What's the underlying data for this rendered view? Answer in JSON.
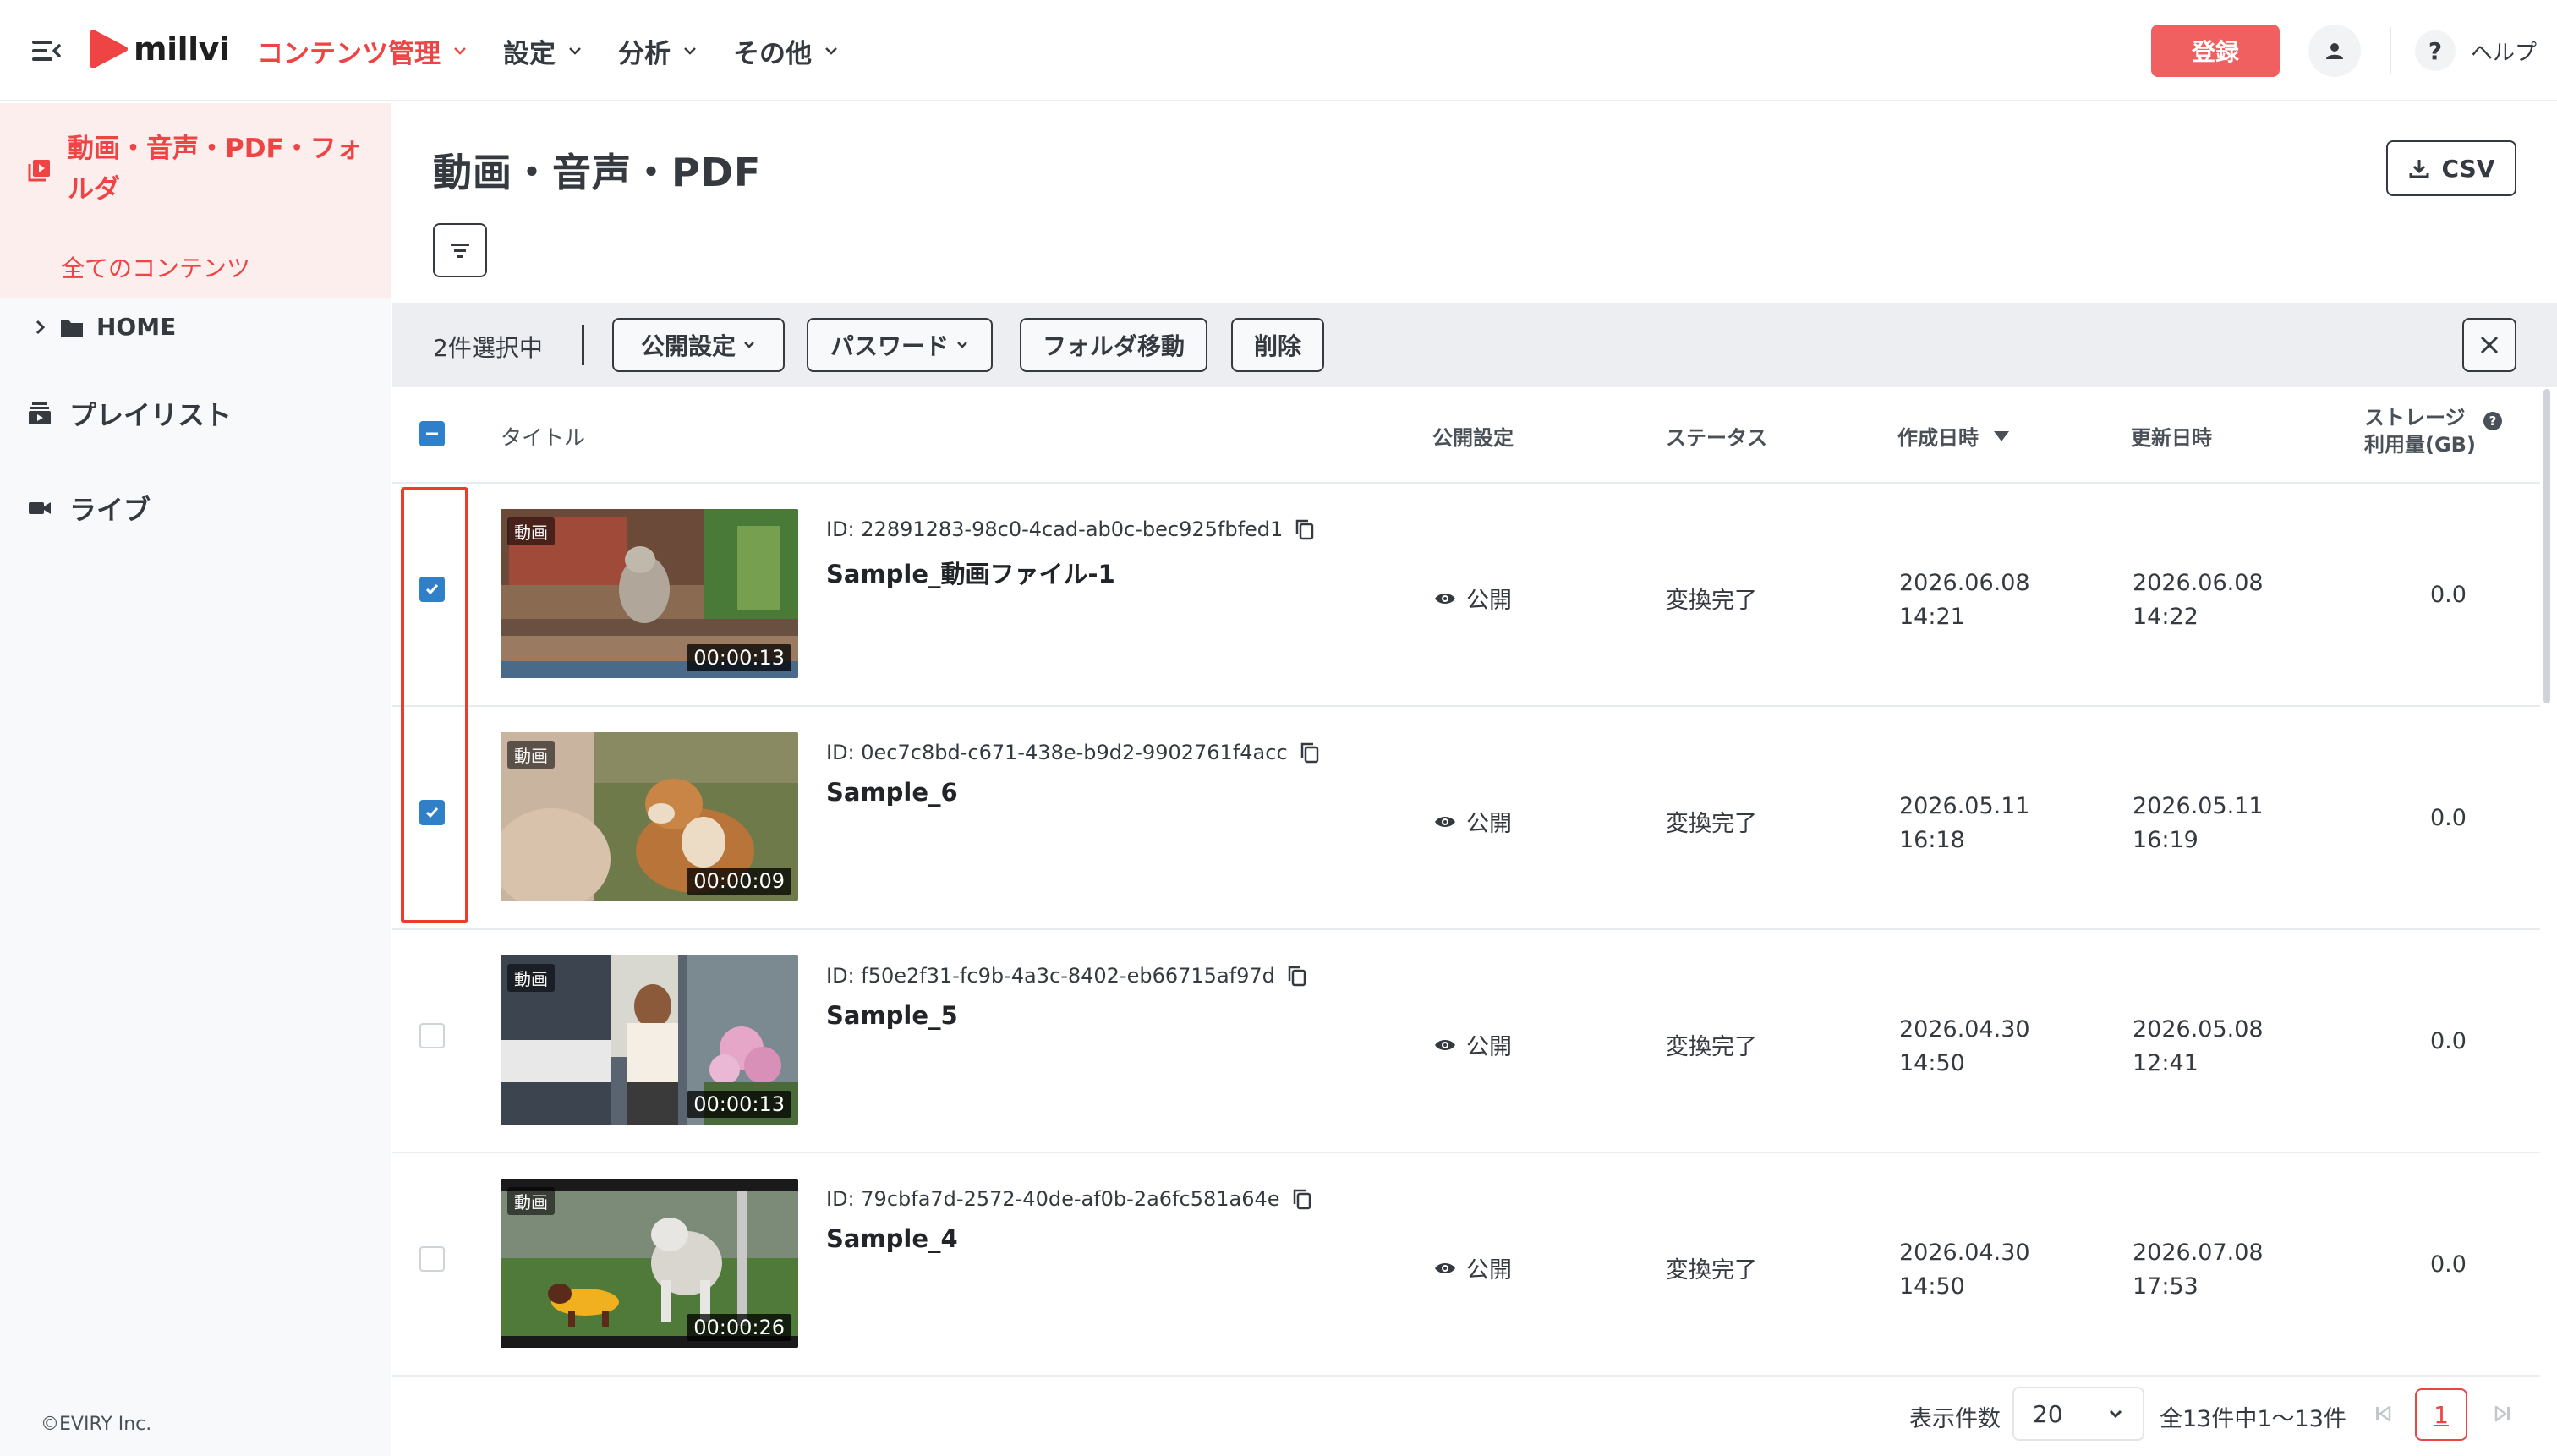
{
  "header": {
    "logo_text": "millvi",
    "nav": [
      {
        "label": "コンテンツ管理",
        "active": true
      },
      {
        "label": "設定",
        "active": false
      },
      {
        "label": "分析",
        "active": false
      },
      {
        "label": "その他",
        "active": false
      }
    ],
    "register_label": "登録",
    "help_symbol": "?",
    "help_label": "ヘルプ"
  },
  "sidebar": {
    "media_label": "動画・音声・PDF・フォルダ",
    "all_contents": "全てのコンテンツ",
    "home": "HOME",
    "playlist": "プレイリスト",
    "live": "ライブ",
    "copyright": "©EVIRY Inc."
  },
  "main": {
    "title": "動画・音声・PDF",
    "csv_label": "CSV"
  },
  "action_bar": {
    "selected": "2件選択中",
    "publish": "公開設定",
    "password": "パスワード",
    "move_folder": "フォルダ移動",
    "delete": "削除"
  },
  "table": {
    "headers": {
      "title": "タイトル",
      "publish": "公開設定",
      "status": "ステータス",
      "created": "作成日時",
      "updated": "更新日時",
      "storage_1": "ストレージ",
      "storage_2": "利用量(GB)"
    },
    "rows": [
      {
        "checked": true,
        "badge": "動画",
        "duration": "00:00:13",
        "id": "ID: 22891283-98c0-4cad-ab0c-bec925fbfed1",
        "title": "Sample_動画ファイル-1",
        "publish": "公開",
        "status": "変換完了",
        "created_date": "2026.06.08",
        "created_time": "14:21",
        "updated_date": "2026.06.08",
        "updated_time": "14:22",
        "storage": "0.0"
      },
      {
        "checked": true,
        "badge": "動画",
        "duration": "00:00:09",
        "id": "ID: 0ec7c8bd-c671-438e-b9d2-9902761f4acc",
        "title": "Sample_6",
        "publish": "公開",
        "status": "変換完了",
        "created_date": "2026.05.11",
        "created_time": "16:18",
        "updated_date": "2026.05.11",
        "updated_time": "16:19",
        "storage": "0.0"
      },
      {
        "checked": false,
        "badge": "動画",
        "duration": "00:00:13",
        "id": "ID: f50e2f31-fc9b-4a3c-8402-eb66715af97d",
        "title": "Sample_5",
        "publish": "公開",
        "status": "変換完了",
        "created_date": "2026.04.30",
        "created_time": "14:50",
        "updated_date": "2026.05.08",
        "updated_time": "12:41",
        "storage": "0.0"
      },
      {
        "checked": false,
        "badge": "動画",
        "duration": "00:00:26",
        "id": "ID: 79cbfa7d-2572-40de-af0b-2a6fc581a64e",
        "title": "Sample_4",
        "publish": "公開",
        "status": "変換完了",
        "created_date": "2026.04.30",
        "created_time": "14:50",
        "updated_date": "2026.07.08",
        "updated_time": "17:53",
        "storage": "0.0"
      }
    ]
  },
  "pagination": {
    "per_page_label": "表示件数",
    "per_page_value": "20",
    "range": "全13件中1〜13件",
    "current_page": "1"
  },
  "colors": {
    "brand": "#ee4444",
    "primary_blue": "#2f80c9",
    "highlight_red": "#ee3b2a"
  }
}
